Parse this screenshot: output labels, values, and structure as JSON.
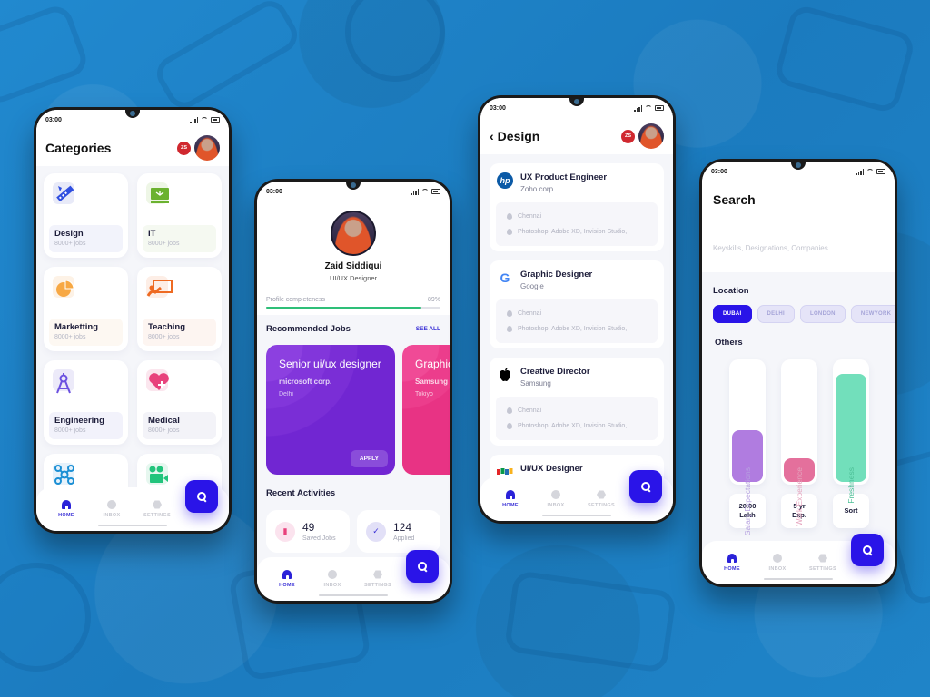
{
  "status_time": "03:00",
  "user": {
    "name": "Zaid Siddiqui",
    "role": "UI/UX Designer",
    "initials": "ZS"
  },
  "bottom_nav": {
    "home": "HOME",
    "inbox": "INBOX",
    "settings": "SETTINGS"
  },
  "colors": {
    "background": "#1f82c6",
    "primary": "#2a14e8",
    "success": "#2ebf78"
  },
  "categories_screen": {
    "title": "Categories",
    "items": [
      {
        "name": "Design",
        "jobs": "8000+ jobs",
        "icon": "ruler-pencil-icon"
      },
      {
        "name": "IT",
        "jobs": "8000+ jobs",
        "icon": "monitor-icon"
      },
      {
        "name": "Marketting",
        "jobs": "8000+ jobs",
        "icon": "pie-chart-icon"
      },
      {
        "name": "Teaching",
        "jobs": "8000+ jobs",
        "icon": "teacher-board-icon"
      },
      {
        "name": "Engineering",
        "jobs": "8000+ jobs",
        "icon": "compass-icon"
      },
      {
        "name": "Medical",
        "jobs": "8000+ jobs",
        "icon": "heart-plus-icon"
      },
      {
        "name": "",
        "jobs": "",
        "icon": "network-icon"
      },
      {
        "name": "",
        "jobs": "",
        "icon": "video-camera-icon"
      }
    ]
  },
  "profile_screen": {
    "completeness_label": "Profile completeness",
    "completeness_value": "89%",
    "completeness_fraction": 0.89,
    "recommended_title": "Recommended Jobs",
    "see_all": "SEE ALL",
    "recommended_jobs": [
      {
        "title": "Senior ui/ux designer",
        "company": "microsoft corp.",
        "location": "Delhi",
        "apply": "APPLY"
      },
      {
        "title": "Graphic designer",
        "company": "Samsung",
        "location": "Tokiyo"
      }
    ],
    "recent_title": "Recent Activities",
    "activities": [
      {
        "value": "49",
        "label": "Saved Jobs",
        "icon": "bookmark-icon"
      },
      {
        "value": "124",
        "label": "Applied",
        "icon": "check-icon"
      }
    ]
  },
  "design_screen": {
    "title": "Design",
    "back": "‹",
    "jobs": [
      {
        "title": "UX Product Engineer",
        "company": "Zoho corp",
        "logo": "hp",
        "location": "Chennai",
        "skills": "Photoshop, Adobe XD, Invision Studio,"
      },
      {
        "title": "Graphic Designer",
        "company": "Google",
        "logo": "G",
        "location": "Chennai",
        "skills": "Photoshop, Adobe XD, Invision Studio,"
      },
      {
        "title": "Creative Director",
        "company": "Samsung",
        "logo": "",
        "location": "Chennai",
        "skills": "Photoshop, Adobe XD, Invision Studio,"
      },
      {
        "title": "UI/UX Designer",
        "company": "",
        "logo": "zoho",
        "location": "",
        "skills": ""
      }
    ]
  },
  "search_screen": {
    "title": "Search",
    "placeholder": "Keyskills, Designations, Companies",
    "location_title": "Location",
    "locations": [
      "DUBAI",
      "DELHI",
      "LONDON",
      "NEWYORK",
      ""
    ],
    "active_location": "DUBAI",
    "others_title": "Others",
    "filters": [
      {
        "label": "Salary Expectations",
        "value_line1": "20.00",
        "value_line2": "Lakh",
        "fill": 0.43,
        "color": "#b07ce0",
        "text_color": "#b7a3e0"
      },
      {
        "label": "Work Experience",
        "value_line1": "5 yr",
        "value_line2": "Exp.",
        "fill": 0.2,
        "color": "#e4709c",
        "text_color": "#e5a3bd"
      },
      {
        "label": "Freshness",
        "value_line1": "Sort",
        "value_line2": "",
        "fill": 0.9,
        "color": "#72dfbb",
        "text_color": "#4cbf96"
      }
    ]
  }
}
